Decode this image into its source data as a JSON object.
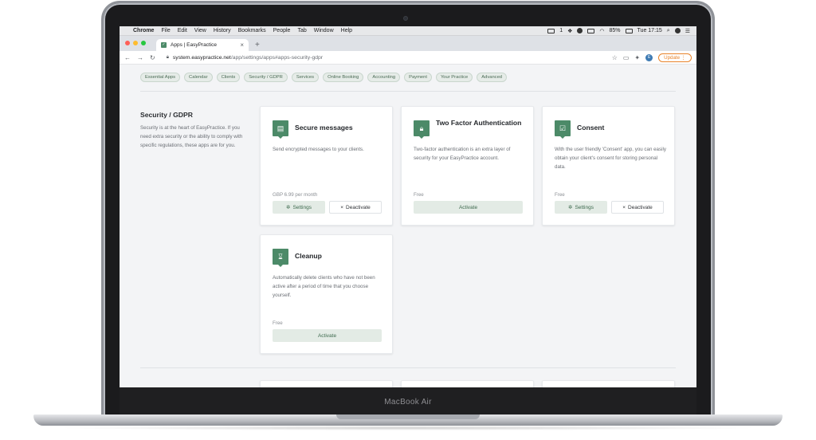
{
  "device": {
    "label": "MacBook Air"
  },
  "menubar": {
    "app": "Chrome",
    "items": [
      "File",
      "Edit",
      "View",
      "History",
      "Bookmarks",
      "People",
      "Tab",
      "Window",
      "Help"
    ],
    "status": {
      "desktop": "1",
      "battery": "85%",
      "clock": "Tue 17:15"
    }
  },
  "browser": {
    "tab_title": "Apps | EasyPractice",
    "new_tab": "+",
    "url_domain": "system.easypractice.net",
    "url_path": "/app/settings/apps#apps-security-gdpr",
    "profile_initial": "E",
    "update_label": "Update"
  },
  "filters": [
    "Essential Apps",
    "Calendar",
    "Clients",
    "Security / GDPR",
    "Services",
    "Online Booking",
    "Accounting",
    "Payment",
    "Your Practice",
    "Advanced"
  ],
  "section": {
    "title": "Security / GDPR",
    "description": "Security is at the heart of EasyPractice. If you need extra security or the ability to comply with specific regulations, these apps are for you."
  },
  "cards": [
    {
      "title": "Secure messages",
      "icon": "message-icon",
      "description": "Send encrypted messages to your clients.",
      "price": "GBP 6.99 per month",
      "settings_label": "Settings",
      "deactivate_label": "Deactivate"
    },
    {
      "title": "Two Factor Authentication",
      "icon": "lock-icon",
      "description": "Two-factor authentication is an extra layer of security for your EasyPractice account.",
      "price": "Free",
      "activate_label": "Activate"
    },
    {
      "title": "Consent",
      "icon": "checkbox-icon",
      "description": "With the user friendly 'Consent' app, you can easily obtain your client's consent for storing personal data.",
      "price": "Free",
      "settings_label": "Settings",
      "deactivate_label": "Deactivate"
    },
    {
      "title": "Cleanup",
      "icon": "hourglass-icon",
      "description": "Automatically delete clients who have not been active after a period of time that you choose yourself.",
      "price": "Free",
      "activate_label": "Activate"
    }
  ],
  "colors": {
    "accent": "#4c8a68",
    "update": "#e8832a",
    "background": "#f3f4f6"
  }
}
